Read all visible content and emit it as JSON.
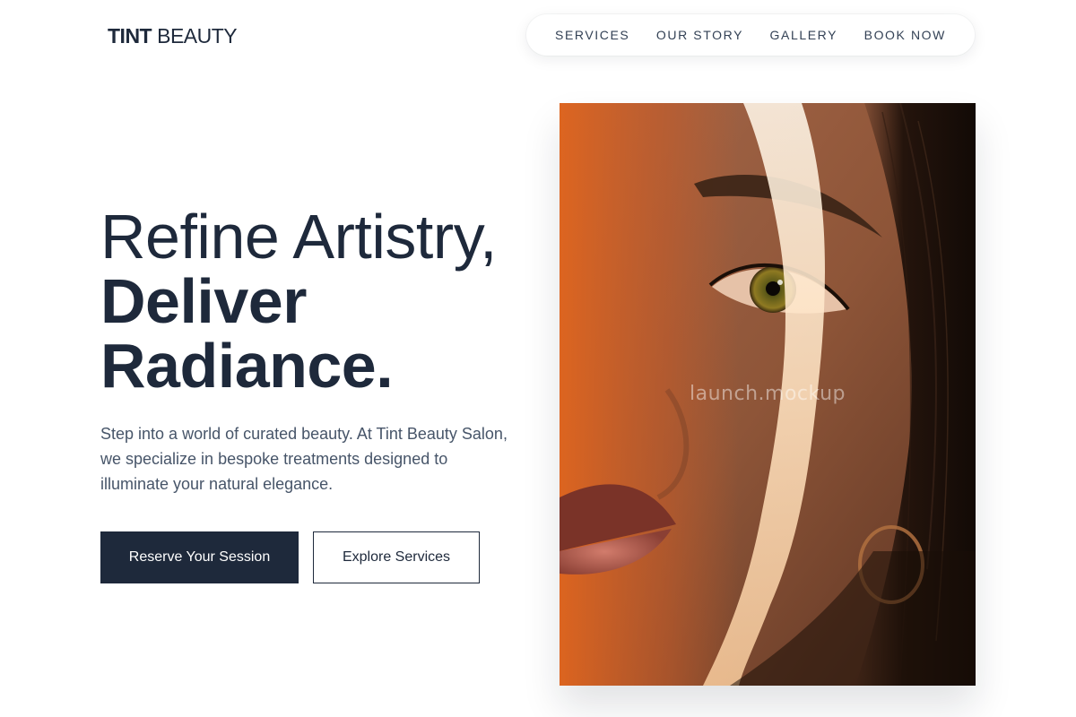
{
  "brand": {
    "name_bold": "TINT",
    "name_light": "BEAUTY"
  },
  "nav": {
    "items": [
      {
        "label": "SERVICES"
      },
      {
        "label": "OUR STORY"
      },
      {
        "label": "GALLERY"
      },
      {
        "label": "BOOK NOW"
      }
    ]
  },
  "hero": {
    "headline_line1": "Refine Artistry,",
    "headline_line2": "Deliver",
    "headline_line3": "Radiance.",
    "description": "Step into a world of curated beauty. At Tint Beauty Salon, we specialize in bespoke treatments designed to illuminate your natural elegance.",
    "primary_button": "Reserve Your Session",
    "secondary_button": "Explore Services",
    "image_watermark": "launch.mockup"
  },
  "colors": {
    "primary_dark": "#1e293b",
    "body_text": "#475569",
    "background": "#ffffff"
  }
}
